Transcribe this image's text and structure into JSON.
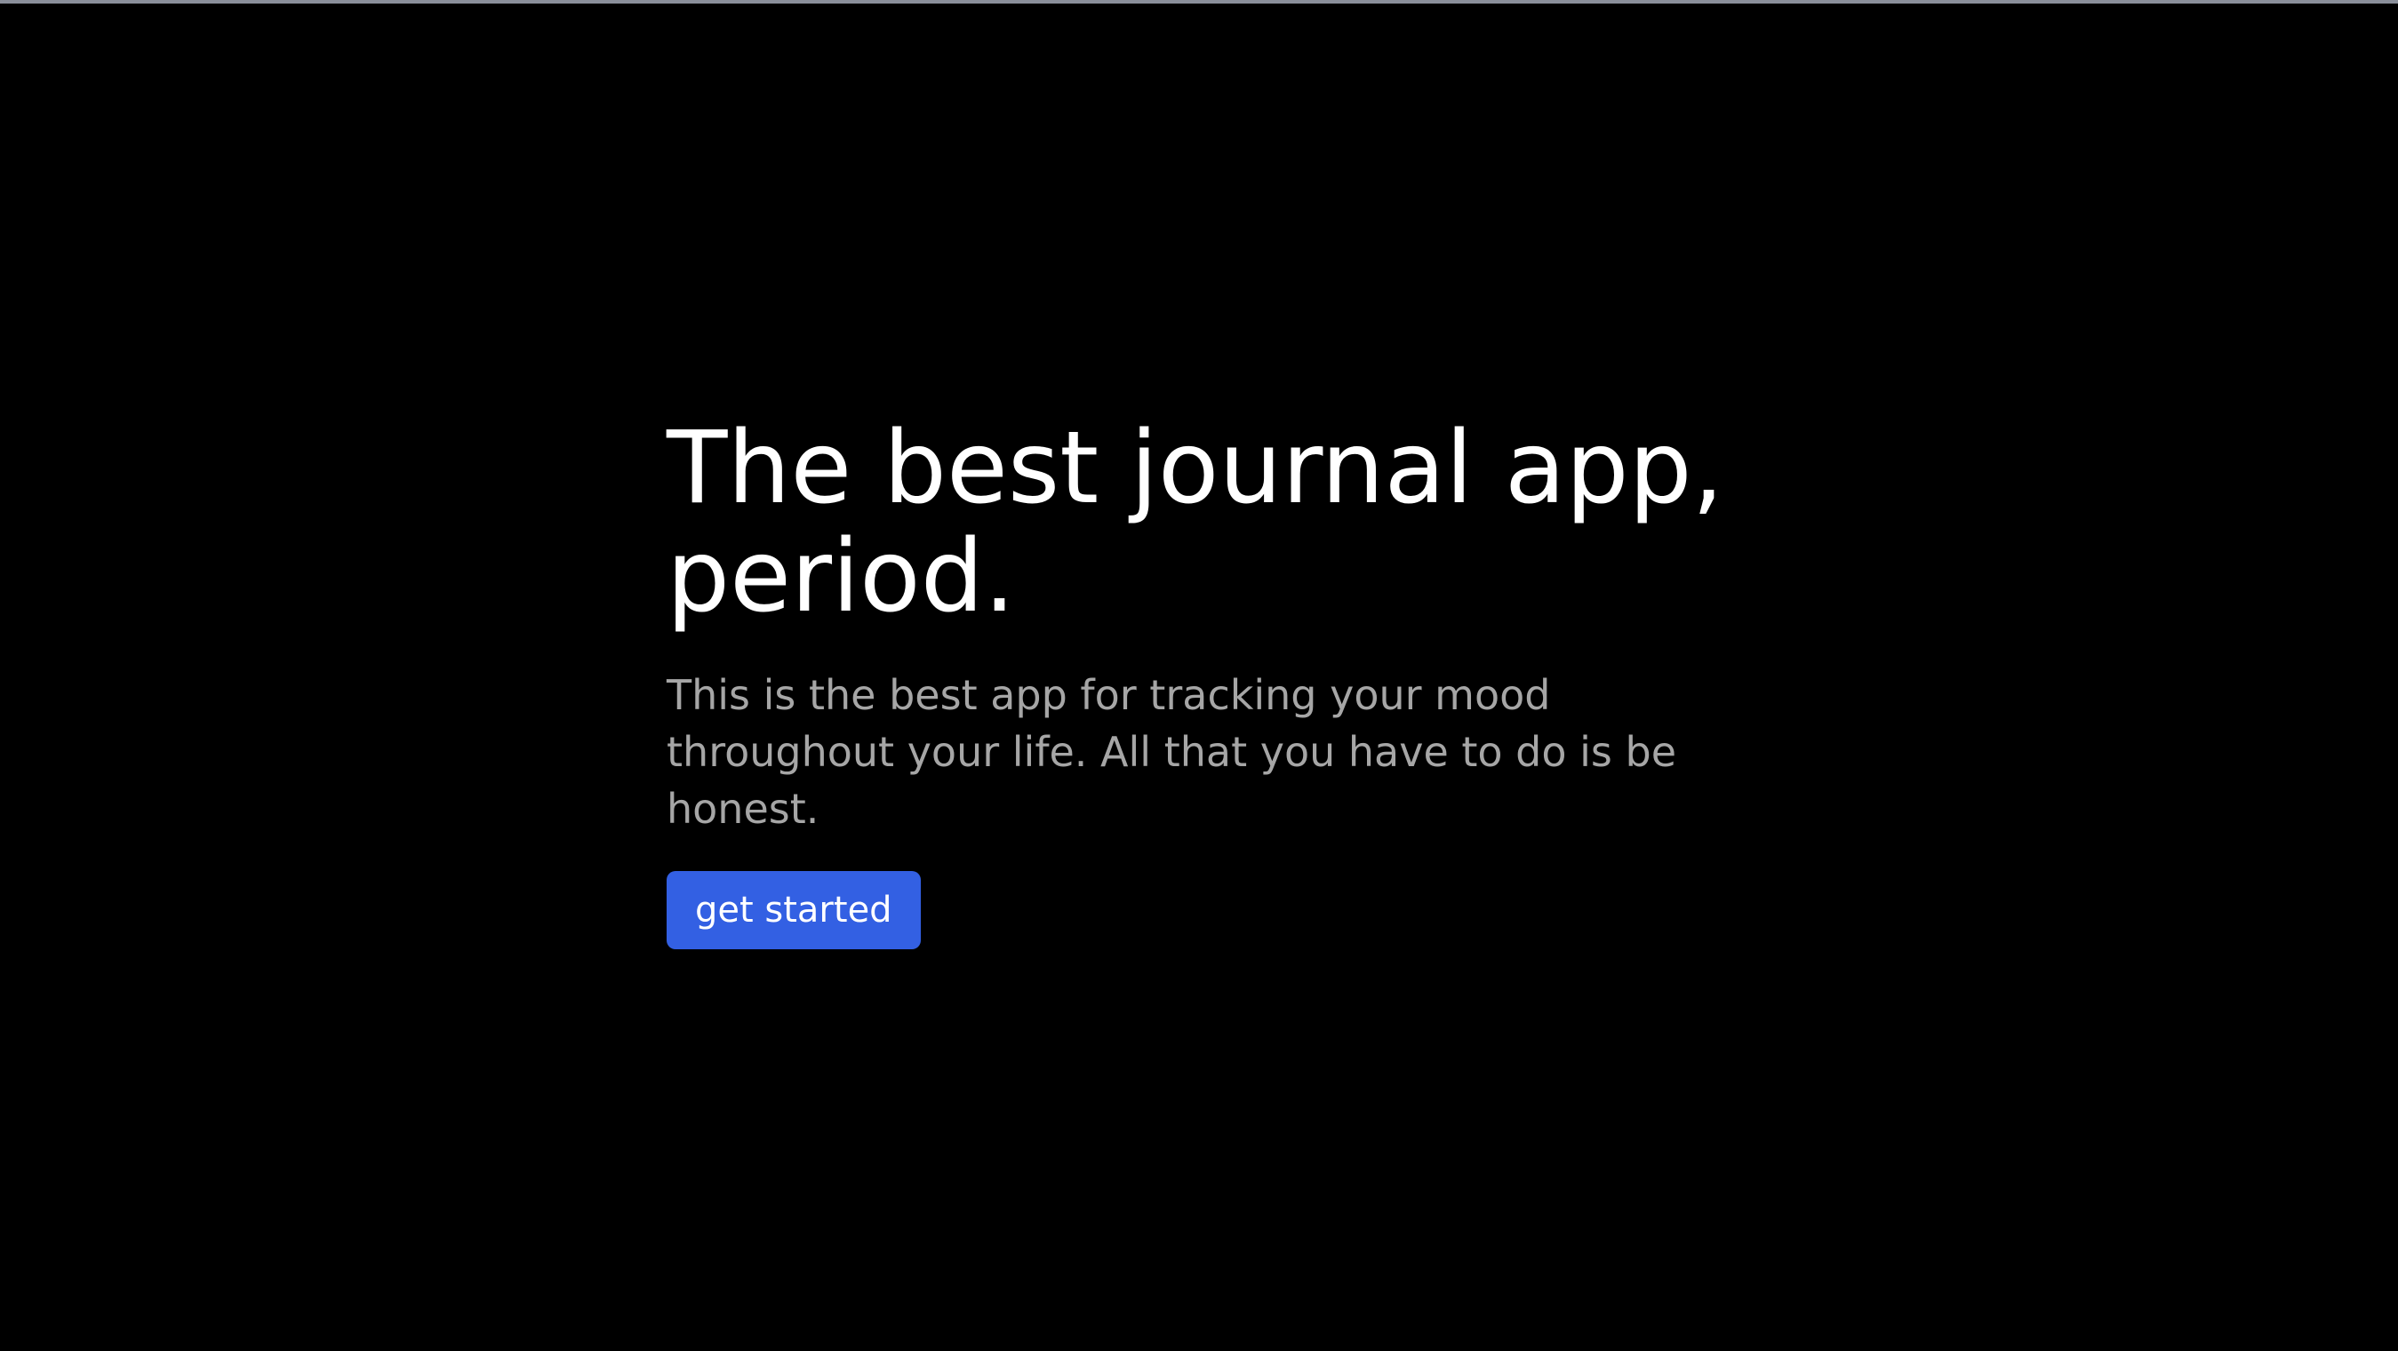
{
  "hero": {
    "title": "The best journal app, period.",
    "subtitle": "This is the best app for tracking your mood throughout your life. All that you have to do is be honest.",
    "cta_label": "get started"
  },
  "colors": {
    "background": "#000000",
    "title_text": "#ffffff",
    "subtitle_text": "#a6a6a6",
    "button_bg": "#3360e3",
    "button_text": "#ffffff",
    "top_edge": "#8a8f9a"
  }
}
